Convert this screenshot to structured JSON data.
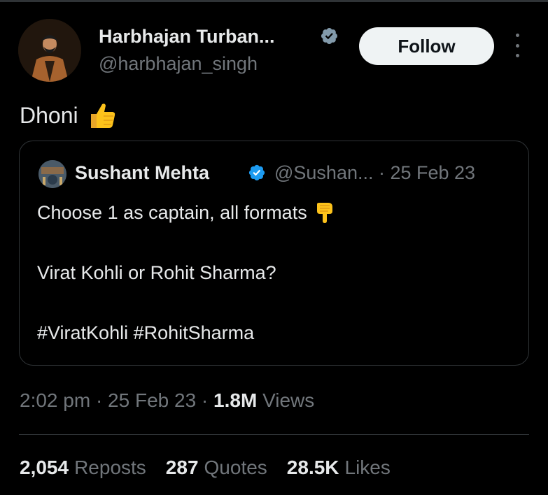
{
  "colors": {
    "background": "#000000",
    "text_primary": "#e7e9ea",
    "text_secondary": "#71767b",
    "verified_author": "#829aab",
    "verified_quote": "#1d9bf0",
    "follow_bg": "#eff3f4",
    "border": "#2f3336"
  },
  "author": {
    "name": "Harbhajan Turban...",
    "handle": "@harbhajan_singh",
    "verified_icon": "verified-badge-icon",
    "follow_label": "Follow",
    "more_icon": "more-options-icon"
  },
  "tweet": {
    "text": "Dhoni",
    "emoji": "thumbs-up-emoji"
  },
  "quote": {
    "name": "Sushant Mehta",
    "handle_time": "@Sushan... · 25 Feb 23",
    "line1": "Choose 1 as captain, all formats",
    "line1_emoji": "pointing-down-emoji",
    "line2": "Virat Kohli or Rohit Sharma?",
    "line3": "#ViratKohli #RohitSharma"
  },
  "meta": {
    "time_date": "2:02 pm · 25 Feb 23 · ",
    "views_count": "1.8M",
    "views_label": " Views"
  },
  "stats": [
    {
      "count": "2,054",
      "label": "Reposts"
    },
    {
      "count": "287",
      "label": "Quotes"
    },
    {
      "count": "28.5K",
      "label": "Likes"
    }
  ]
}
